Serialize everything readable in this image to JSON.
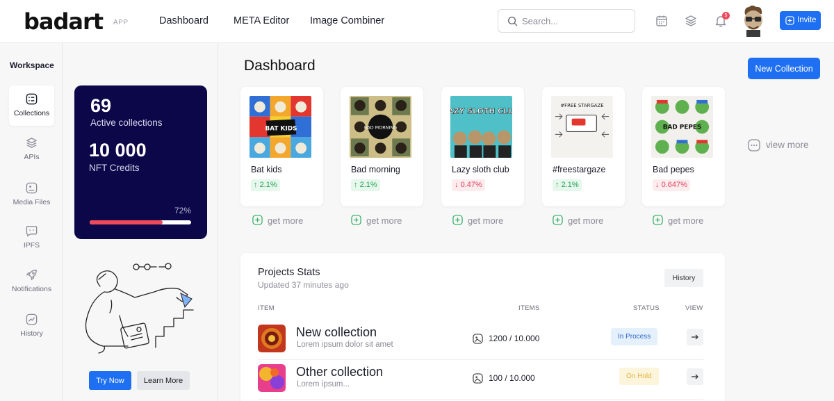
{
  "app": {
    "logo": "badart",
    "logo_tag": "APP"
  },
  "topnav": [
    {
      "label": "Dashboard"
    },
    {
      "label": "META Editor"
    },
    {
      "label": "Image Combiner"
    }
  ],
  "search": {
    "placeholder": "Search..."
  },
  "notifications": {
    "count": "5"
  },
  "invite_label": "Invite",
  "sidebar": {
    "title": "Workspace",
    "items": [
      {
        "label": "Collections",
        "icon": "collections-icon",
        "active": true
      },
      {
        "label": "APIs",
        "icon": "layers-icon"
      },
      {
        "label": "Media Files",
        "icon": "media-files-icon"
      },
      {
        "label": "IPFS",
        "icon": "ipfs-icon"
      },
      {
        "label": "Notifications",
        "icon": "rocket-icon"
      },
      {
        "label": "History",
        "icon": "chart-icon"
      }
    ]
  },
  "promo": {
    "collections_count": "69",
    "collections_label": "Active collections",
    "credits_count": "10 000",
    "credits_label": "NFT Credits",
    "progress_label": "72%",
    "progress_fraction": 0.72,
    "try_label": "Try Now",
    "learn_label": "Learn More"
  },
  "main": {
    "title": "Dashboard",
    "new_collection_label": "New Collection",
    "view_more_label": "view more",
    "get_more_label": "get more"
  },
  "collections": [
    {
      "name": "Bat kids",
      "change": "2.1%",
      "direction": "up",
      "thumb_text": "BAT KIDS"
    },
    {
      "name": "Bad morning",
      "change": "2.1%",
      "direction": "up",
      "thumb_text": "BAD MORNING"
    },
    {
      "name": "Lazy sloth club",
      "change": "0.47%",
      "direction": "down",
      "thumb_text": "LAZY SLOTH CLUB"
    },
    {
      "name": "#freestargaze",
      "change": "2.1%",
      "direction": "up",
      "thumb_text": "#FREE STARGAZE"
    },
    {
      "name": "Bad pepes",
      "change": "0.647%",
      "direction": "down",
      "thumb_text": "BAD PEPES"
    }
  ],
  "stats": {
    "title": "Projects Stats",
    "subtitle": "Updated 37 minutes ago",
    "history_label": "History",
    "columns": {
      "item": "ITEM",
      "items": "ITEMS",
      "status": "STATUS",
      "view": "VIEW"
    },
    "rows": [
      {
        "name": "New collection",
        "desc": "Lorem ipsum dolor sit amet",
        "items": "1200 / 10.000",
        "status": "In Process",
        "status_type": "process"
      },
      {
        "name": "Other collection",
        "desc": "Lorem ipsum...",
        "items": "100 / 10.000",
        "status": "On Hold",
        "status_type": "hold"
      }
    ]
  },
  "colors": {
    "accent": "#1e6ff2",
    "card_dark": "#0c0749",
    "progress": "#ef4a5a",
    "up": "#27a35a",
    "down": "#e0415a"
  }
}
